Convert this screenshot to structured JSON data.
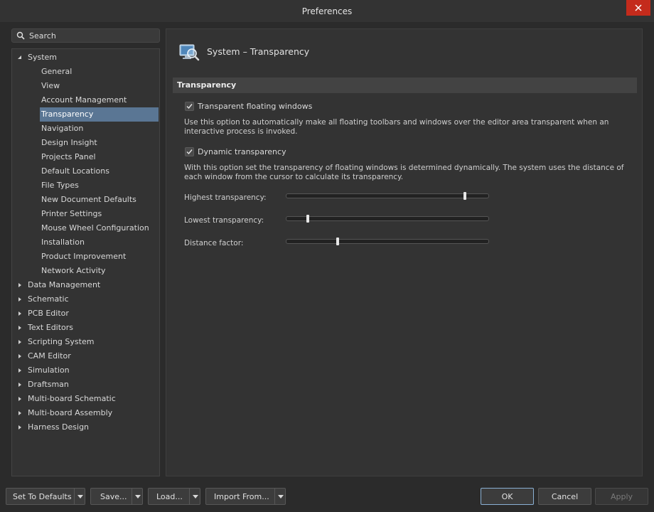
{
  "window": {
    "title": "Preferences"
  },
  "search": {
    "placeholder": "Search"
  },
  "tree": {
    "system": {
      "label": "System",
      "expanded": true
    },
    "children": [
      "General",
      "View",
      "Account Management",
      "Transparency",
      "Navigation",
      "Design Insight",
      "Projects Panel",
      "Default Locations",
      "File Types",
      "New Document Defaults",
      "Printer Settings",
      "Mouse Wheel Configuration",
      "Installation",
      "Product Improvement",
      "Network Activity"
    ],
    "selected": "Transparency",
    "sections": [
      "Data Management",
      "Schematic",
      "PCB Editor",
      "Text Editors",
      "Scripting System",
      "CAM Editor",
      "Simulation",
      "Draftsman",
      "Multi-board Schematic",
      "Multi-board Assembly",
      "Harness Design"
    ]
  },
  "page": {
    "title": "System – Transparency",
    "section_header": "Transparency",
    "transparent_floating": {
      "label": "Transparent floating windows",
      "checked": true,
      "description_line1": "Use this option to automatically make all floating toolbars and windows over the editor area transparent when an",
      "description_line2": "interactive process is invoked."
    },
    "dynamic_transparency": {
      "label": "Dynamic transparency",
      "checked": true,
      "description_line1": "With this option set the transparency of floating windows is determined dynamically. The system uses the distance of",
      "description_line2": "each window from the cursor to calculate its transparency."
    },
    "sliders": {
      "highest": {
        "label": "Highest transparency:",
        "value": 0.89
      },
      "lowest": {
        "label": "Lowest transparency:",
        "value": 0.1
      },
      "distance": {
        "label": "Distance factor:",
        "value": 0.25
      }
    }
  },
  "footer": {
    "set_to_defaults": "Set To Defaults",
    "save": "Save...",
    "load": "Load...",
    "import_from": "Import From...",
    "ok": "OK",
    "cancel": "Cancel",
    "apply": "Apply"
  },
  "colors": {
    "selection": "#5a7694",
    "close_button": "#c42b1c"
  }
}
